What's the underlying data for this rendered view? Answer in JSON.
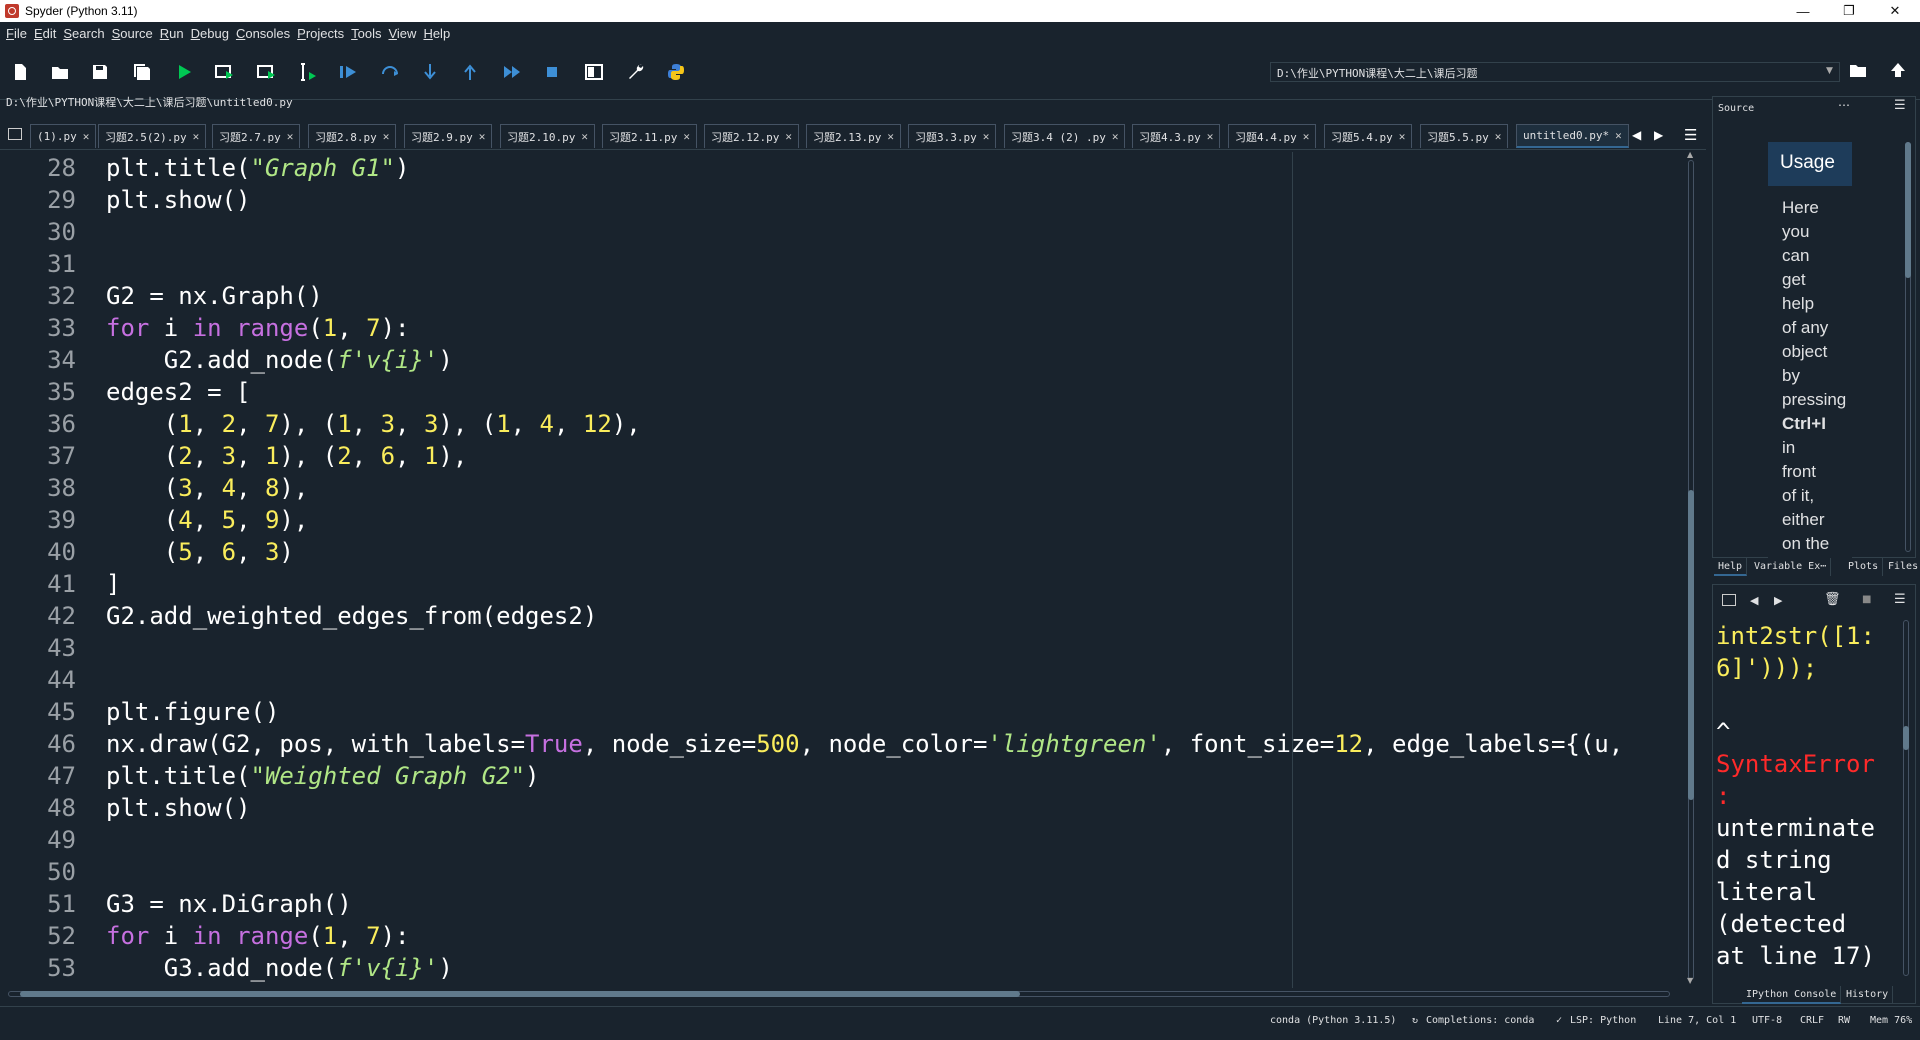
{
  "window": {
    "title": "Spyder (Python 3.11)"
  },
  "menu": [
    "File",
    "Edit",
    "Search",
    "Source",
    "Run",
    "Debug",
    "Consoles",
    "Projects",
    "Tools",
    "View",
    "Help"
  ],
  "toolbar": {
    "working_directory": "D:\\作业\\PYTHON课程\\大二上\\课后习题"
  },
  "editor": {
    "file_path": "D:\\作业\\PYTHON课程\\大二上\\课后习题\\untitled0.py",
    "tabs": [
      "(1).py",
      "习题2.5(2).py",
      "习题2.7.py",
      "习题2.8.py",
      "习题2.9.py",
      "习题2.10.py",
      "习题2.11.py",
      "习题2.12.py",
      "习题2.13.py",
      "习题3.3.py",
      "习题3.4 (2) .py",
      "习题4.3.py",
      "习题4.4.py",
      "习题5.4.py",
      "习题5.5.py",
      "untitled0.py*"
    ],
    "active_tab": "untitled0.py*",
    "line_numbers": [
      "28",
      "29",
      "30",
      "31",
      "32",
      "33",
      "34",
      "35",
      "36",
      "37",
      "38",
      "39",
      "40",
      "41",
      "42",
      "43",
      "44",
      "45",
      "46",
      "47",
      "48",
      "49",
      "50",
      "51",
      "52",
      "53"
    ],
    "lines": {
      "l28_a": "plt.title(",
      "l28_s": "\"Graph G1\"",
      "l28_b": ")",
      "l29": "plt.show()",
      "l32": "G2 = nx.Graph()",
      "l33_kw1": "for",
      "l33_a": " i ",
      "l33_kw2": "in",
      "l33_sp": " ",
      "l33_kw3": "range",
      "l33_b": "(",
      "l33_n1": "1",
      "l33_c": ", ",
      "l33_n2": "7",
      "l33_d": "):",
      "l34_a": "    G2.add_node(",
      "l34_s": "f'v{i}'",
      "l34_b": ")",
      "l35": "edges2 = [",
      "l36_a": "    (",
      "l36_n1": "1",
      "l36_c1": ", ",
      "l36_n2": "2",
      "l36_c2": ", ",
      "l36_n3": "7",
      "l36_b": "), (",
      "l36_n4": "1",
      "l36_c3": ", ",
      "l36_n5": "3",
      "l36_c4": ", ",
      "l36_n6": "3",
      "l36_d": "), (",
      "l36_n7": "1",
      "l36_c5": ", ",
      "l36_n8": "4",
      "l36_c6": ", ",
      "l36_n9": "12",
      "l36_e": "),",
      "l37_a": "    (",
      "l37_n1": "2",
      "l37_c1": ", ",
      "l37_n2": "3",
      "l37_c2": ", ",
      "l37_n3": "1",
      "l37_b": "), (",
      "l37_n4": "2",
      "l37_c3": ", ",
      "l37_n5": "6",
      "l37_c4": ", ",
      "l37_n6": "1",
      "l37_e": "),",
      "l38_a": "    (",
      "l38_n1": "3",
      "l38_c1": ", ",
      "l38_n2": "4",
      "l38_c2": ", ",
      "l38_n3": "8",
      "l38_e": "),",
      "l39_a": "    (",
      "l39_n1": "4",
      "l39_c1": ", ",
      "l39_n2": "5",
      "l39_c2": ", ",
      "l39_n3": "9",
      "l39_e": "),",
      "l40_a": "    (",
      "l40_n1": "5",
      "l40_c1": ", ",
      "l40_n2": "6",
      "l40_c2": ", ",
      "l40_n3": "3",
      "l40_e": ")",
      "l41": "]",
      "l42": "G2.add_weighted_edges_from(edges2)",
      "l45": "plt.figure()",
      "l46_a": "nx.draw(G2, pos, with_labels=",
      "l46_t": "True",
      "l46_b": ", node_size=",
      "l46_n1": "500",
      "l46_c": ", node_color=",
      "l46_s": "'lightgreen'",
      "l46_d": ", font_size=",
      "l46_n2": "12",
      "l46_e": ", edge_labels={(u,",
      "l47_a": "plt.title(",
      "l47_s": "\"Weighted Graph G2\"",
      "l47_b": ")",
      "l48": "plt.show()",
      "l51": "G3 = nx.DiGraph()",
      "l52_kw1": "for",
      "l52_a": " i ",
      "l52_kw2": "in",
      "l52_sp": " ",
      "l52_kw3": "range",
      "l52_b": "(",
      "l52_n1": "1",
      "l52_c": ", ",
      "l52_n2": "7",
      "l52_d": "):",
      "l53_a": "    G3.add_node(",
      "l53_s": "f'v{i}'",
      "l53_b": ")"
    }
  },
  "help_pane": {
    "source_label": "Source",
    "more": "⋯",
    "usage_title": "Usage",
    "usage_words": [
      "Here",
      "you",
      "can",
      "get",
      "help",
      "of any",
      "object",
      "by",
      "pressing"
    ],
    "usage_bold": "Ctrl+I",
    "usage_words2": [
      "in",
      "front",
      "of it,",
      "either",
      "on the"
    ],
    "tabs": [
      "Help",
      "Variable Ex⋯",
      "Plots",
      "Files"
    ]
  },
  "console": {
    "lines_yellow": [
      "int2str([1:",
      "6]')));"
    ],
    "caret": "^",
    "error_lines": [
      "SyntaxError",
      ":"
    ],
    "message_lines": [
      "unterminate",
      "d string",
      "literal",
      "(detected",
      "at line 17)"
    ],
    "tabs": [
      "IPython Console",
      "History"
    ]
  },
  "statusbar": {
    "env": "conda (Python 3.11.5)",
    "completions": "Completions: conda",
    "lsp": "LSP: Python",
    "cursor": "Line 7, Col 1",
    "encoding": "UTF-8",
    "eol": "CRLF",
    "perm": "RW",
    "mem": "Mem 76%"
  },
  "colors": {
    "background": "#19232d",
    "keyword": "#c670e0",
    "number": "#faed5c",
    "string": "#b0e686",
    "error": "#ff2a2a"
  }
}
